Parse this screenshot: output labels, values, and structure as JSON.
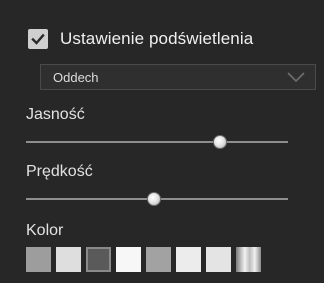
{
  "backlight": {
    "label": "Ustawienie podświetlenia",
    "enabled": true
  },
  "effect_dropdown": {
    "selected": "Oddech"
  },
  "brightness": {
    "label": "Jasność",
    "value": 0.74
  },
  "speed": {
    "label": "Prędkość",
    "value": 0.49
  },
  "color": {
    "label": "Kolor",
    "swatches": [
      {
        "color": "#9d9d9d",
        "selected": false
      },
      {
        "color": "#dedede",
        "selected": false
      },
      {
        "color": "#5a5a5a",
        "selected": true
      },
      {
        "color": "#f7f7f7",
        "selected": false
      },
      {
        "color": "#a2a2a2",
        "selected": false
      },
      {
        "color": "#ececec",
        "selected": false
      },
      {
        "color": "#e4e4e4",
        "selected": false
      },
      {
        "color": "gradient",
        "selected": false
      }
    ]
  }
}
